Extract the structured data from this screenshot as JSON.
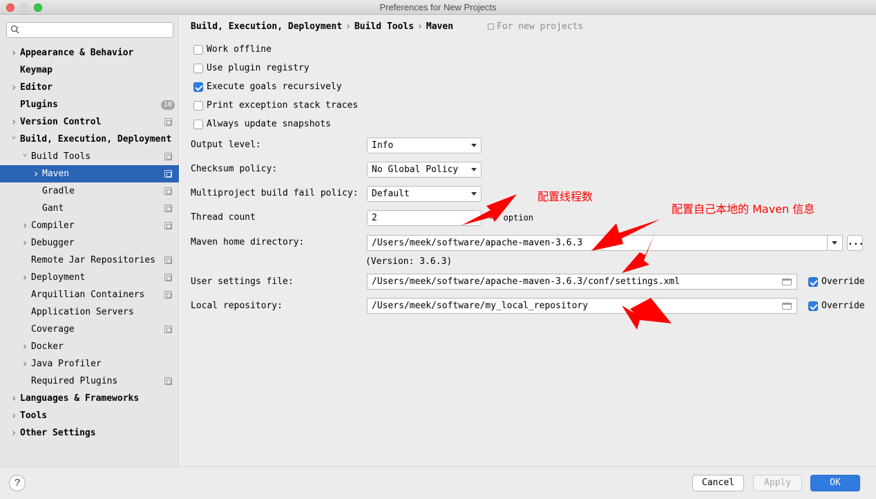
{
  "window": {
    "title": "Preferences for New Projects"
  },
  "search": {
    "placeholder": ""
  },
  "sidebar": {
    "items": [
      {
        "label": "Appearance & Behavior",
        "expandable": true,
        "bold": true,
        "level": 0
      },
      {
        "label": "Keymap",
        "expandable": false,
        "bold": true,
        "level": 0
      },
      {
        "label": "Editor",
        "expandable": true,
        "bold": true,
        "level": 0
      },
      {
        "label": "Plugins",
        "expandable": false,
        "bold": true,
        "level": 0,
        "badge": "10"
      },
      {
        "label": "Version Control",
        "expandable": true,
        "bold": true,
        "level": 0,
        "project": true
      },
      {
        "label": "Build, Execution, Deployment",
        "expandable": true,
        "expanded": true,
        "bold": true,
        "level": 0
      },
      {
        "label": "Build Tools",
        "expandable": true,
        "expanded": true,
        "level": 1,
        "project": true
      },
      {
        "label": "Maven",
        "expandable": true,
        "level": 2,
        "project": true,
        "selected": true
      },
      {
        "label": "Gradle",
        "level": 2,
        "project": true
      },
      {
        "label": "Gant",
        "level": 2,
        "project": true
      },
      {
        "label": "Compiler",
        "expandable": true,
        "level": 1,
        "project": true
      },
      {
        "label": "Debugger",
        "expandable": true,
        "level": 1
      },
      {
        "label": "Remote Jar Repositories",
        "level": 1,
        "project": true
      },
      {
        "label": "Deployment",
        "expandable": true,
        "level": 1,
        "project": true
      },
      {
        "label": "Arquillian Containers",
        "level": 1,
        "project": true
      },
      {
        "label": "Application Servers",
        "level": 1
      },
      {
        "label": "Coverage",
        "level": 1,
        "project": true
      },
      {
        "label": "Docker",
        "expandable": true,
        "level": 1
      },
      {
        "label": "Java Profiler",
        "expandable": true,
        "level": 1
      },
      {
        "label": "Required Plugins",
        "level": 1,
        "project": true
      },
      {
        "label": "Languages & Frameworks",
        "expandable": true,
        "bold": true,
        "level": 0
      },
      {
        "label": "Tools",
        "expandable": true,
        "bold": true,
        "level": 0
      },
      {
        "label": "Other Settings",
        "expandable": true,
        "bold": true,
        "level": 0
      }
    ]
  },
  "breadcrumb": {
    "part1": "Build, Execution, Deployment",
    "sep": "›",
    "part2": "Build Tools",
    "part3": "Maven",
    "scope": "For new projects"
  },
  "options": {
    "work_offline": {
      "label": "Work offline",
      "checked": false
    },
    "use_plugin_registry": {
      "label": "Use plugin registry",
      "checked": false
    },
    "execute_goals_recursively": {
      "label": "Execute goals recursively",
      "checked": true
    },
    "print_exception_stack_traces": {
      "label": "Print exception stack traces",
      "checked": false
    },
    "always_update_snapshots": {
      "label": "Always update snapshots",
      "checked": false
    }
  },
  "fields": {
    "output_level": {
      "label": "Output level:",
      "value": "Info"
    },
    "checksum_policy": {
      "label": "Checksum policy:",
      "value": "No Global Policy"
    },
    "multiproject_fail_policy": {
      "label": "Multiproject build fail policy:",
      "value": "Default"
    },
    "thread_count": {
      "label": "Thread count",
      "value": "2",
      "hint": "-T option"
    },
    "maven_home": {
      "label": "Maven home directory:",
      "value": "/Users/meek/software/apache-maven-3.6.3",
      "version": "(Version: 3.6.3)",
      "browse": "..."
    },
    "user_settings": {
      "label": "User settings file:",
      "value": "/Users/meek/software/apache-maven-3.6.3/conf/settings.xml",
      "override_label": "Override",
      "override": true
    },
    "local_repo": {
      "label": "Local repository:",
      "value": "/Users/meek/software/my_local_repository",
      "override_label": "Override",
      "override": true
    }
  },
  "annotations": {
    "thread_note": "配置线程数",
    "maven_note": "配置自己本地的 Maven 信息",
    "color": "#ff0000"
  },
  "footer": {
    "help": "?",
    "cancel": "Cancel",
    "apply": "Apply",
    "ok": "OK"
  },
  "colors": {
    "selection": "#2a64b4",
    "ok_button": "#2f7be0",
    "checkbox_checked": "#2e7de1"
  }
}
